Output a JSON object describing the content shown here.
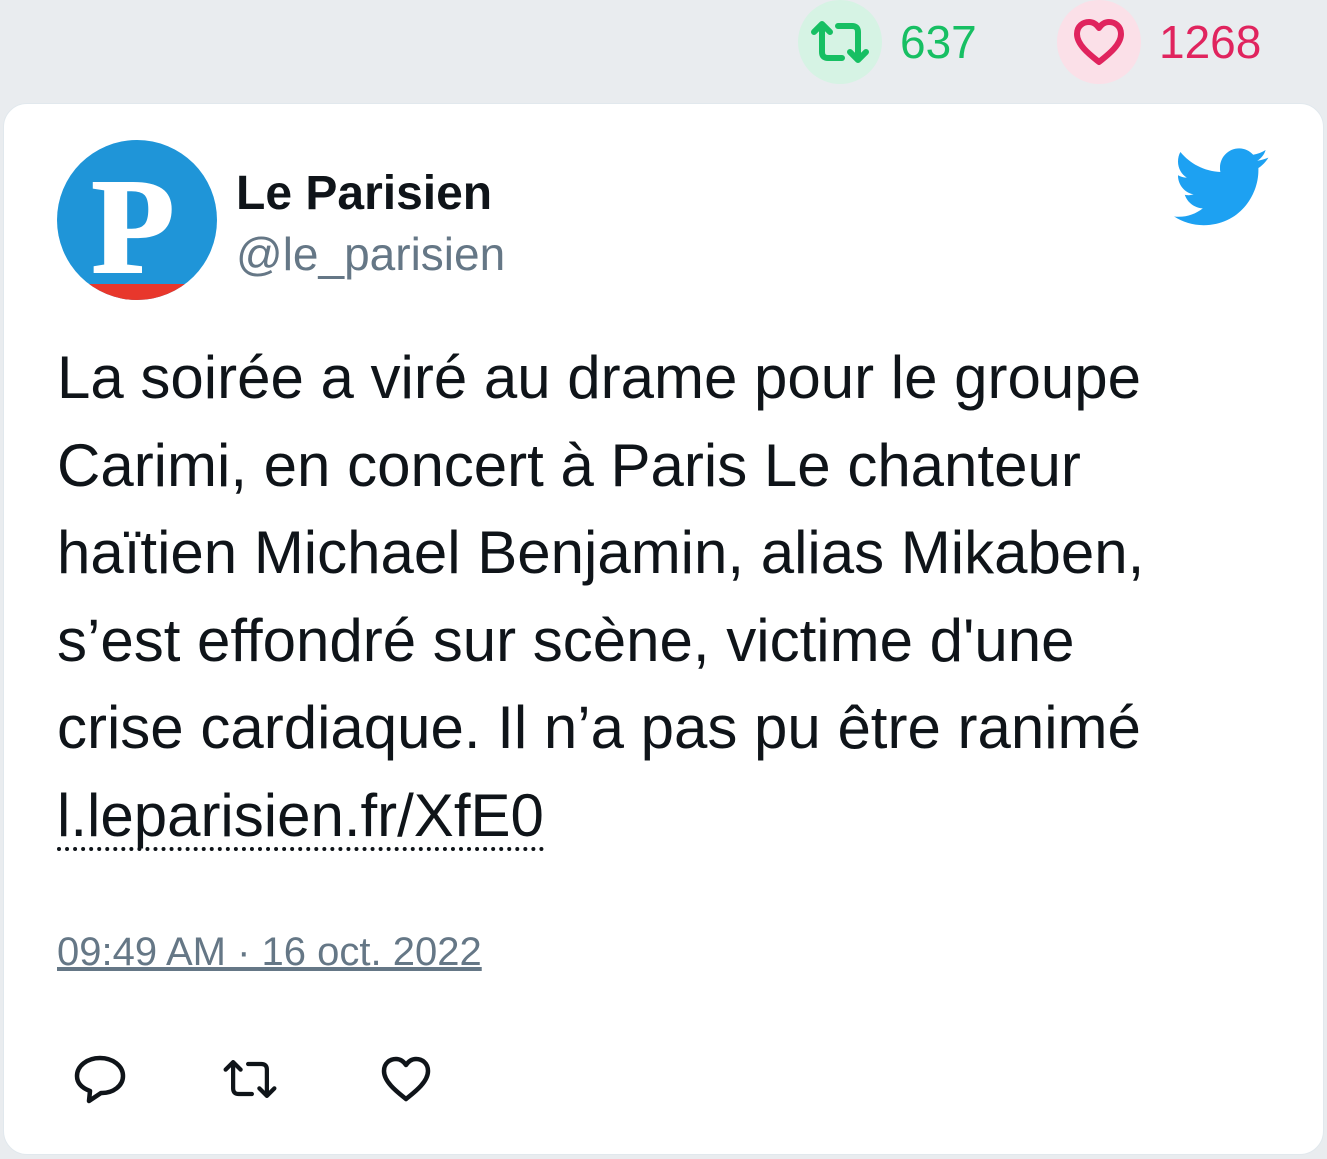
{
  "stats": {
    "retweet_icon": "retweet-icon",
    "retweet_count": "637",
    "retweet_color": "#17bf63",
    "like_icon": "heart-icon",
    "like_count": "1268",
    "like_color": "#e0245e"
  },
  "tweet": {
    "author": {
      "name": "Le Parisien",
      "handle": "@le_parisien",
      "avatar_letter": "P",
      "avatar_color": "#1f95d8"
    },
    "brand_icon": "twitter-bird-icon",
    "brand_color": "#1da1f2",
    "text_lines": [
      "La soirée a viré au drame pour le groupe",
      "Carimi, en concert à Paris Le chanteur",
      "haïtien Michael Benjamin, alias Mikaben,",
      "s’est effondré sur scène, victime d'une",
      "crise cardiaque. Il n’a pas pu être ranimé"
    ],
    "link": "l.leparisien.fr/XfE0",
    "timestamp": "09:49 AM · 16 oct. 2022",
    "actions": [
      "reply-icon",
      "retweet-icon",
      "like-icon"
    ]
  }
}
